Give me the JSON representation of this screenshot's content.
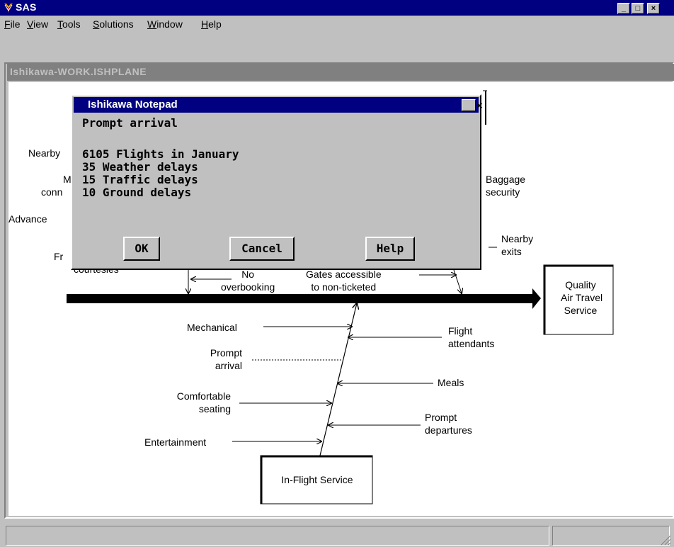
{
  "app": {
    "title": "SAS"
  },
  "menu": {
    "items": [
      "File",
      "View",
      "Tools",
      "Solutions",
      "Window",
      "Help"
    ],
    "underline": [
      "F",
      "V",
      "T",
      "S",
      "W",
      "H"
    ]
  },
  "document": {
    "title": "Ishikawa-WORK.ISHPLANE"
  },
  "diagram": {
    "effect": "Quality\nAir Travel\nService",
    "bottom_box": "In-Flight Service",
    "labels": {
      "nearby_partial": "Nearby",
      "m_partial": "M",
      "conn_partial": "conn",
      "advance_partial": "Advance",
      "fr_partial": "Fr",
      "courtesies": "courtesies",
      "no_overbooking": "No\noverbooking",
      "gates": "Gates accessible\nto non-ticketed",
      "baggage_security": "Baggage\nsecurity",
      "nearby_exits": "Nearby\nexits",
      "mechanical": "Mechanical",
      "prompt_arrival": "Prompt\narrival",
      "comfortable_seating": "Comfortable\nseating",
      "entertainment": "Entertainment",
      "flight_attendants": "Flight\nattendants",
      "meals": "Meals",
      "prompt_departures": "Prompt\ndepartures"
    }
  },
  "dialog": {
    "title": "Ishikawa Notepad",
    "lines": [
      "Prompt arrival",
      "",
      "6105 Flights in January",
      "35 Weather delays",
      "15 Traffic delays",
      "10 Ground delays"
    ],
    "ok": "OK",
    "cancel": "Cancel",
    "help": "Help"
  },
  "colors": {
    "title_active": "#000080",
    "title_inactive": "#808080",
    "face": "#c0c0c0"
  }
}
